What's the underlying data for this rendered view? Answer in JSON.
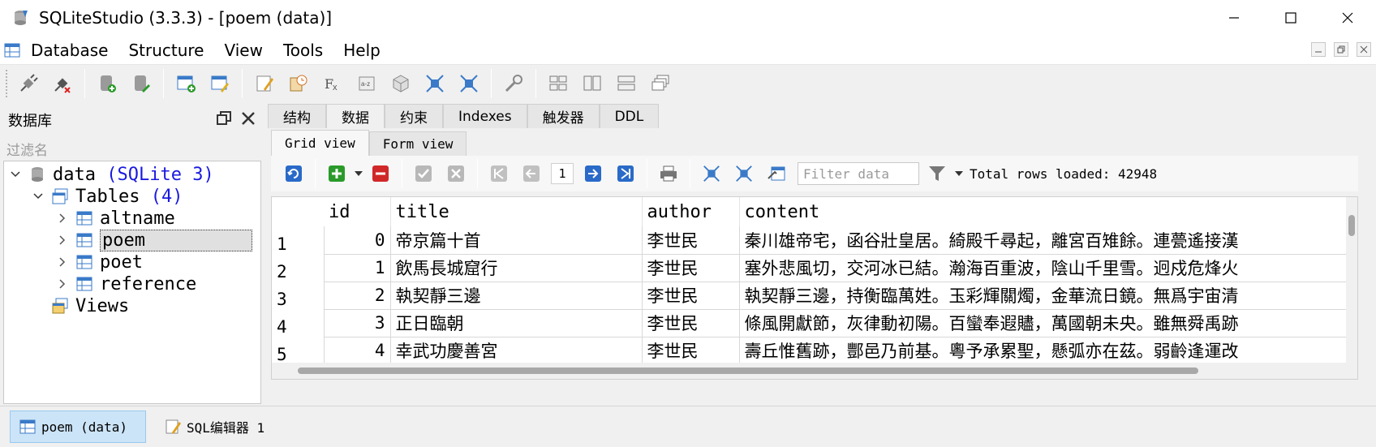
{
  "window": {
    "title": "SQLiteStudio (3.3.3) - [poem (data)]"
  },
  "menubar": {
    "items": [
      {
        "label": "Database"
      },
      {
        "label": "Structure"
      },
      {
        "label": "View"
      },
      {
        "label": "Tools"
      },
      {
        "label": "Help"
      }
    ]
  },
  "left_panel": {
    "title": "数据库",
    "filter_placeholder": "过滤名",
    "tree": {
      "db_name": "data",
      "db_type": "(SQLite 3)",
      "tables_label": "Tables",
      "tables_count": "(4)",
      "tables": [
        "altname",
        "poem",
        "poet",
        "reference"
      ],
      "views_label": "Views"
    }
  },
  "tabs": {
    "items": [
      "结构",
      "数据",
      "约束",
      "Indexes",
      "触发器",
      "DDL"
    ],
    "active": "数据"
  },
  "subtabs": {
    "items": [
      "Grid view",
      "Form view"
    ],
    "active": "Grid view"
  },
  "grid_toolbar": {
    "page": "1",
    "filter_placeholder": "Filter data",
    "total_rows": "Total rows loaded: 42948"
  },
  "grid": {
    "columns": [
      "id",
      "title",
      "author",
      "content"
    ],
    "rows": [
      {
        "rownum": "1",
        "id": "0",
        "title": "帝京篇十首",
        "author": "李世民",
        "content": "秦川雄帝宅，函谷壯皇居。綺殿千尋起，離宮百雉餘。連甍遙接漢"
      },
      {
        "rownum": "2",
        "id": "1",
        "title": "飲馬長城窟行",
        "author": "李世民",
        "content": "塞外悲風切，交河冰已結。瀚海百重波，陰山千里雪。迥戍危烽火"
      },
      {
        "rownum": "3",
        "id": "2",
        "title": "執契靜三邊",
        "author": "李世民",
        "content": "執契靜三邊，持衡臨萬姓。玉彩輝關燭，金華流日鏡。無爲宇宙清"
      },
      {
        "rownum": "4",
        "id": "3",
        "title": "正日臨朝",
        "author": "李世民",
        "content": "條風開獻節，灰律動初陽。百蠻奉遐贐，萬國朝未央。雖無舜禹跡"
      },
      {
        "rownum": "5",
        "id": "4",
        "title": "幸武功慶善宮",
        "author": "李世民",
        "content": "壽丘惟舊跡，酆邑乃前基。粵予承累聖，懸弧亦在茲。弱齡逢運改"
      }
    ]
  },
  "bottom_bar": {
    "tasks": [
      {
        "label": "poem (data)",
        "active": true
      },
      {
        "label": "SQL编辑器 1",
        "active": false
      }
    ]
  },
  "colors": {
    "accent_blue": "#1a1adf",
    "selected_task": "#cce4f7",
    "toolbar_bg": "#f0f0f0"
  }
}
